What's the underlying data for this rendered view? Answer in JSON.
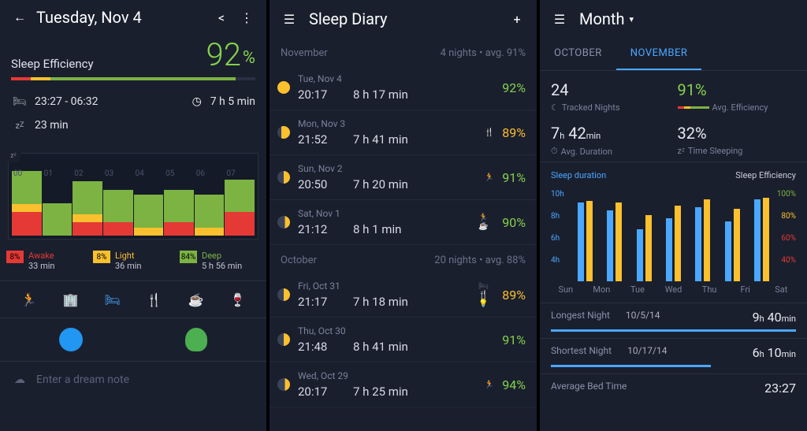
{
  "pane1": {
    "date": "Tuesday, Nov 4",
    "eff_label": "Sleep Efficiency",
    "eff_value": "92",
    "eff_pct": "%",
    "bed_range": "23:27 - 06:32",
    "duration": "7 h 5 min",
    "z_label": "23 min",
    "hours": [
      "00",
      "01",
      "02",
      "03",
      "04",
      "05",
      "06",
      "07"
    ],
    "legend": {
      "awake": {
        "pct": "8%",
        "label": "Awake",
        "val": "33 min",
        "color": "#e53935"
      },
      "light": {
        "pct": "8%",
        "label": "Light",
        "val": "36 min",
        "color": "#fbc02d"
      },
      "deep": {
        "pct": "84%",
        "label": "Deep",
        "val": "5 h 56 min",
        "color": "#7cb342"
      }
    },
    "note_placeholder": "Enter a dream note"
  },
  "pane2": {
    "title": "Sleep Diary",
    "sections": [
      {
        "name": "November",
        "meta": "4 nights  •  avg. 91%",
        "entries": [
          {
            "moon": "full",
            "date": "Tue, Nov 4",
            "time": "20:17",
            "dur": "8 h 17 min",
            "pct": "92%",
            "cls": ""
          },
          {
            "moon": "gib",
            "date": "Mon, Nov 3",
            "time": "21:52",
            "dur": "7 h 41 min",
            "pct": "89%",
            "cls": "yl",
            "ic": "🍴"
          },
          {
            "moon": "half",
            "date": "Sun, Nov 2",
            "time": "20:50",
            "dur": "7 h 20 min",
            "pct": "91%",
            "cls": "",
            "ic": "🏃"
          },
          {
            "moon": "cres",
            "date": "Sat, Nov 1",
            "time": "21:12",
            "dur": "8 h 1 min",
            "pct": "90%",
            "cls": "",
            "ic": "🏃☕"
          }
        ]
      },
      {
        "name": "October",
        "meta": "20 nights  •  avg. 88%",
        "entries": [
          {
            "moon": "half",
            "date": "Fri, Oct 31",
            "time": "21:17",
            "dur": "7 h 18 min",
            "pct": "89%",
            "cls": "yl",
            "ic": "🛏🍴💡"
          },
          {
            "moon": "half",
            "date": "Thu, Oct 30",
            "time": "21:48",
            "dur": "8 h 41 min",
            "pct": "91%",
            "cls": ""
          },
          {
            "moon": "cres",
            "date": "Wed, Oct 29",
            "time": "20:17",
            "dur": "7 h 25 min",
            "pct": "94%",
            "cls": "",
            "ic": "🏃"
          }
        ]
      }
    ]
  },
  "pane3": {
    "title": "Month",
    "tabs": [
      "OCTOBER",
      "NOVEMBER"
    ],
    "active_tab": 1,
    "stats": {
      "nights": {
        "v": "24",
        "l": "Tracked Nights",
        "ic": "☾"
      },
      "eff": {
        "v": "91%",
        "l": "Avg. Efficiency",
        "bar": true
      },
      "dur": {
        "v_h": "7",
        "v_m": "42",
        "l": "Avg. Duration",
        "ic": "⏱"
      },
      "sleep": {
        "v": "32%",
        "l": "Time Sleeping",
        "ic": "zᶻ"
      }
    },
    "chart": {
      "left_label": "Sleep duration",
      "right_label": "Sleep Efficiency",
      "yleft": [
        "10h",
        "8h",
        "6h",
        "4h"
      ],
      "yright": [
        "100%",
        "80%",
        "60%",
        "40%"
      ],
      "days": [
        "Sun",
        "Mon",
        "Tue",
        "Wed",
        "Thu",
        "Fri",
        "Sat"
      ]
    },
    "longest": {
      "label": "Longest Night",
      "date": "10/5/14",
      "h": "9",
      "m": "40"
    },
    "shortest": {
      "label": "Shortest Night",
      "date": "10/17/14",
      "h": "6",
      "m": "10"
    },
    "avg_bed": {
      "label": "Average Bed Time",
      "time": "23:27"
    }
  },
  "chart_data": [
    {
      "type": "bar",
      "title": "Sleep phases timeline",
      "categories": [
        "00",
        "01",
        "02",
        "03",
        "04",
        "05",
        "06",
        "07"
      ],
      "series": [
        {
          "name": "Deep",
          "color": "#7cb342"
        },
        {
          "name": "Light",
          "color": "#fbc02d"
        },
        {
          "name": "Awake",
          "color": "#e53935"
        }
      ],
      "note": "stacked bars per minute; aggregate Awake 33 min, Light 36 min, Deep 5h56m"
    },
    {
      "type": "bar",
      "title": "Sleep duration & efficiency by weekday",
      "categories": [
        "Sun",
        "Mon",
        "Tue",
        "Wed",
        "Thu",
        "Fri",
        "Sat"
      ],
      "series": [
        {
          "name": "Sleep duration (h)",
          "color": "#4aa8ff",
          "values": [
            9.0,
            8.5,
            7.3,
            8.0,
            8.7,
            7.8,
            9.2
          ]
        },
        {
          "name": "Sleep efficiency (%)",
          "color": "#fbc02d",
          "values": [
            91,
            90,
            82,
            88,
            92,
            86,
            93
          ]
        }
      ],
      "yleft": {
        "label": "hours",
        "min": 4,
        "max": 10
      },
      "yright": {
        "label": "%",
        "min": 40,
        "max": 100
      }
    }
  ]
}
